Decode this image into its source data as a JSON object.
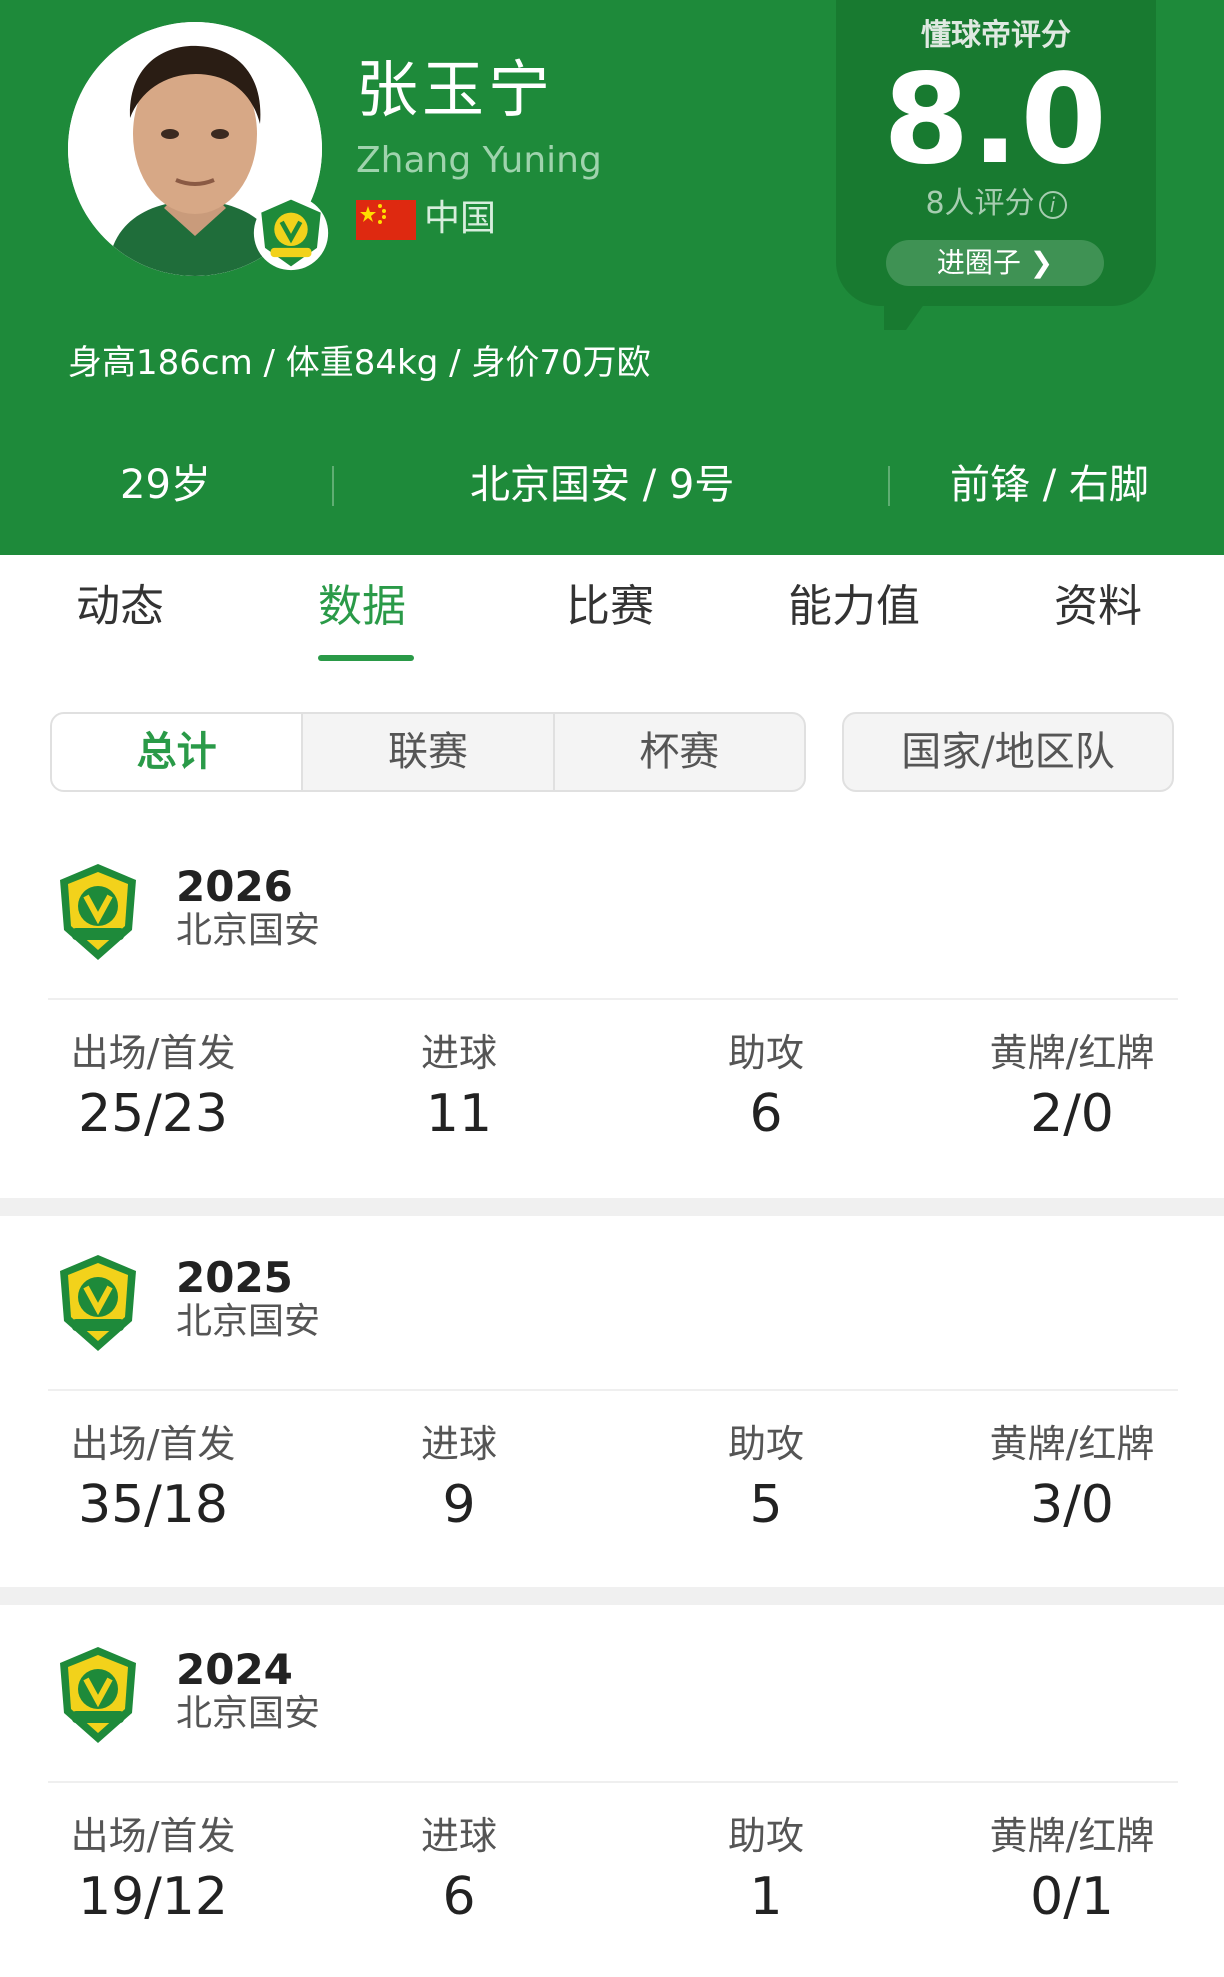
{
  "header": {
    "name_cn": "张玉宁",
    "name_en": "Zhang Yuning",
    "country": "中国",
    "body_stats": "身高186cm / 体重84kg / 身价70万欧",
    "age": "29岁",
    "club_number": "北京国安 / 9号",
    "position_foot": "前锋 / 右脚",
    "colors": {
      "primary_green": "#1e8a3a",
      "accent_green": "#2a9a48"
    }
  },
  "rating": {
    "title": "懂球帝评分",
    "score": "8.0",
    "count": "8人评分",
    "join_label": "进圈子 ❯"
  },
  "tabs": [
    {
      "label": "动态"
    },
    {
      "label": "数据",
      "active": true
    },
    {
      "label": "比赛"
    },
    {
      "label": "能力值"
    },
    {
      "label": "资料"
    }
  ],
  "filters": {
    "segments": [
      {
        "label": "总计",
        "active": true
      },
      {
        "label": "联赛"
      },
      {
        "label": "杯赛"
      }
    ],
    "national": "国家/地区队"
  },
  "labels": {
    "apps": "出场/首发",
    "goals": "进球",
    "assists": "助攻",
    "cards": "黄牌/红牌"
  },
  "seasons": [
    {
      "year": "2026",
      "team": "北京国安",
      "apps": "25/23",
      "goals": "11",
      "assists": "6",
      "cards": "2/0"
    },
    {
      "year": "2025",
      "team": "北京国安",
      "apps": "35/18",
      "goals": "9",
      "assists": "5",
      "cards": "3/0"
    },
    {
      "year": "2024",
      "team": "北京国安",
      "apps": "19/12",
      "goals": "6",
      "assists": "1",
      "cards": "0/1"
    }
  ],
  "icons": [
    "club-badge-icon",
    "china-flag-icon",
    "info-icon",
    "chevron-right-icon"
  ]
}
